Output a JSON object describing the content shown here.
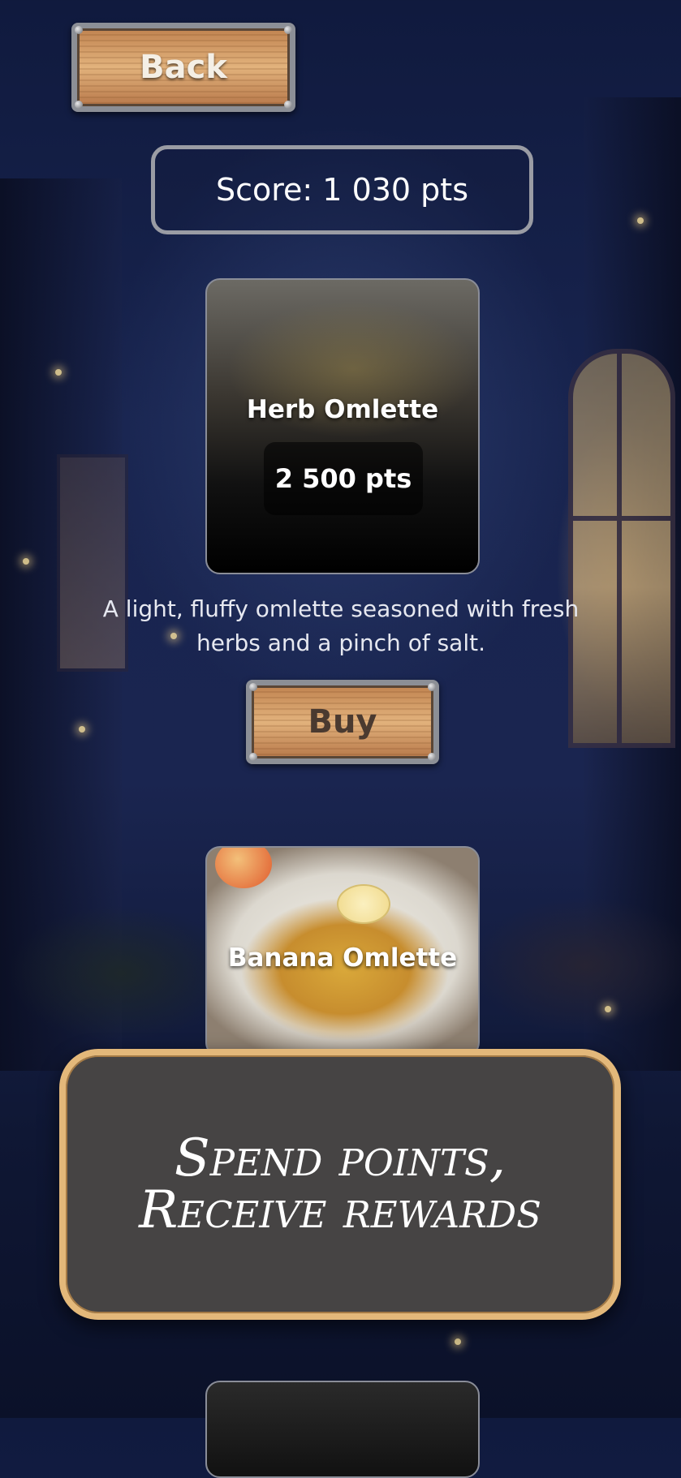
{
  "header": {
    "back_label": "Back"
  },
  "score": {
    "text": "Score: 1 030 pts"
  },
  "items": [
    {
      "name": "Herb Omlette",
      "price": "2 500 pts",
      "description": "A light, fluffy omlette seasoned with fresh herbs and a pinch of salt.",
      "buy_label": "Buy"
    },
    {
      "name": "Banana Omlette"
    }
  ],
  "banner": {
    "line1": "Spend points,",
    "line2": "Receive rewards"
  }
}
